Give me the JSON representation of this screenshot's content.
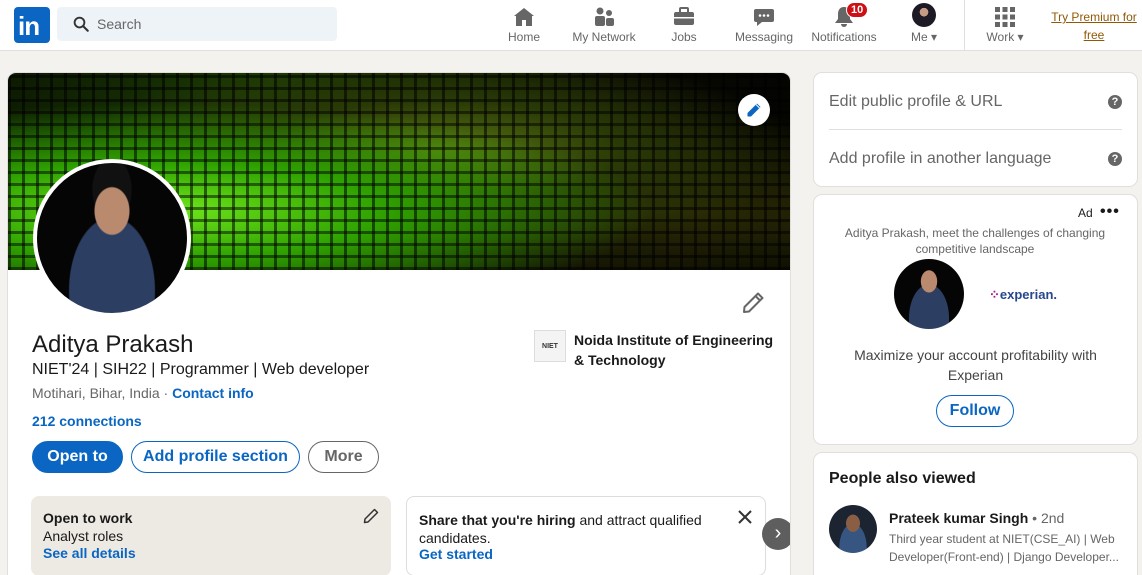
{
  "nav": {
    "search_placeholder": "Search",
    "items": [
      {
        "label": "Home",
        "icon": "home-icon"
      },
      {
        "label": "My Network",
        "icon": "network-icon"
      },
      {
        "label": "Jobs",
        "icon": "briefcase-icon"
      },
      {
        "label": "Messaging",
        "icon": "messaging-icon"
      },
      {
        "label": "Notifications",
        "icon": "bell-icon",
        "badge": "10"
      },
      {
        "label": "Me",
        "icon": "avatar"
      },
      {
        "label": "Work",
        "icon": "grid-icon"
      }
    ],
    "premium_line1": "Try Premium for",
    "premium_line2": "free",
    "brand_color": "#0a66c2"
  },
  "profile": {
    "name": "Aditya Prakash",
    "headline": "NIET'24 | SIH22 | Programmer | Web developer",
    "location": "Motihari, Bihar, India",
    "location_sep": " · ",
    "contact_info": "Contact info",
    "connections": "212 connections",
    "education_logo_text": "NIET",
    "education": "Noida Institute of Engineering & Technology",
    "buttons": {
      "open_to": "Open to",
      "add_section": "Add profile section",
      "more": "More"
    },
    "open_to_work": {
      "title": "Open to work",
      "roles": "Analyst roles",
      "link": "See all details"
    },
    "hiring": {
      "bold": "Share that you're hiring",
      "rest": " and attract qualified candidates.",
      "link": "Get started"
    }
  },
  "right_rail": {
    "edit_public_profile": "Edit public profile & URL",
    "add_language": "Add profile in another language",
    "help_glyph": "?",
    "ad": {
      "label": "Ad",
      "menu": "•••",
      "description": "Aditya Prakash, meet the challenges of changing competitive landscape",
      "brand": "experian.",
      "headline": "Maximize your account profitability with Experian",
      "cta": "Follow"
    },
    "people_also_viewed": {
      "title": "People also viewed",
      "people": [
        {
          "name": "Prateek kumar Singh",
          "degree": " • 2nd",
          "headline": "Third year student at NIET(CSE_AI) | Web Developer(Front-end) | Django Developer..."
        }
      ]
    }
  }
}
